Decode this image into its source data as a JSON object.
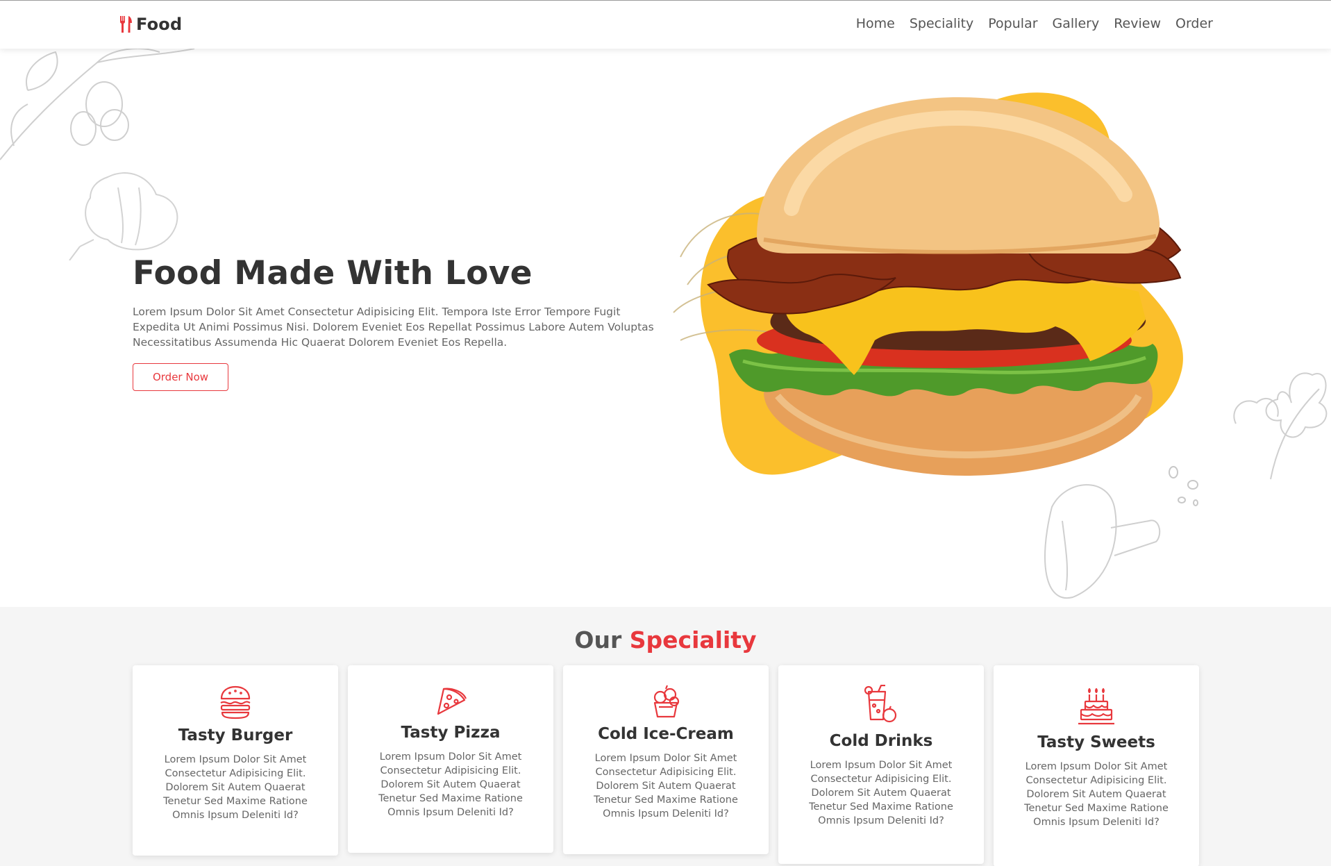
{
  "brand": {
    "name": "Food",
    "icon": "fork-knife-icon",
    "accent_color": "#e8383d",
    "yellow": "#fbbf2c"
  },
  "nav": {
    "items": [
      {
        "label": "Home"
      },
      {
        "label": "Speciality"
      },
      {
        "label": "Popular"
      },
      {
        "label": "Gallery"
      },
      {
        "label": "Review"
      },
      {
        "label": "Order"
      }
    ]
  },
  "hero": {
    "title": "Food Made With Love",
    "description": "Lorem Ipsum Dolor Sit Amet Consectetur Adipisicing Elit. Tempora Iste Error Tempore Fugit Expedita Ut Animi Possimus Nisi. Dolorem Eveniet Eos Repellat Possimus Labore Autem Voluptas Necessitatibus Assumenda Hic Quaerat Dolorem Eveniet Eos Repella.",
    "button": "Order Now",
    "image": "burger-image"
  },
  "speciality": {
    "title_prefix": "Our",
    "title_accent": "Speciality",
    "cards": [
      {
        "title": "Tasty Burger",
        "icon": "burger-icon",
        "text": "Lorem Ipsum Dolor Sit Amet Consectetur Adipisicing Elit. Dolorem Sit Autem Quaerat Tenetur Sed Maxime Ratione Omnis Ipsum Deleniti Id?"
      },
      {
        "title": "Tasty Pizza",
        "icon": "pizza-icon",
        "text": "Lorem Ipsum Dolor Sit Amet Consectetur Adipisicing Elit. Dolorem Sit Autem Quaerat Tenetur Sed Maxime Ratione Omnis Ipsum Deleniti Id?"
      },
      {
        "title": "Cold Ice-Cream",
        "icon": "ice-cream-icon",
        "text": "Lorem Ipsum Dolor Sit Amet Consectetur Adipisicing Elit. Dolorem Sit Autem Quaerat Tenetur Sed Maxime Ratione Omnis Ipsum Deleniti Id?"
      },
      {
        "title": "Cold Drinks",
        "icon": "drink-icon",
        "text": "Lorem Ipsum Dolor Sit Amet Consectetur Adipisicing Elit. Dolorem Sit Autem Quaerat Tenetur Sed Maxime Ratione Omnis Ipsum Deleniti Id?"
      },
      {
        "title": "Tasty Sweets",
        "icon": "cake-icon",
        "text": "Lorem Ipsum Dolor Sit Amet Consectetur Adipisicing Elit. Dolorem Sit Autem Quaerat Tenetur Sed Maxime Ratione Omnis Ipsum Deleniti Id?"
      }
    ]
  }
}
